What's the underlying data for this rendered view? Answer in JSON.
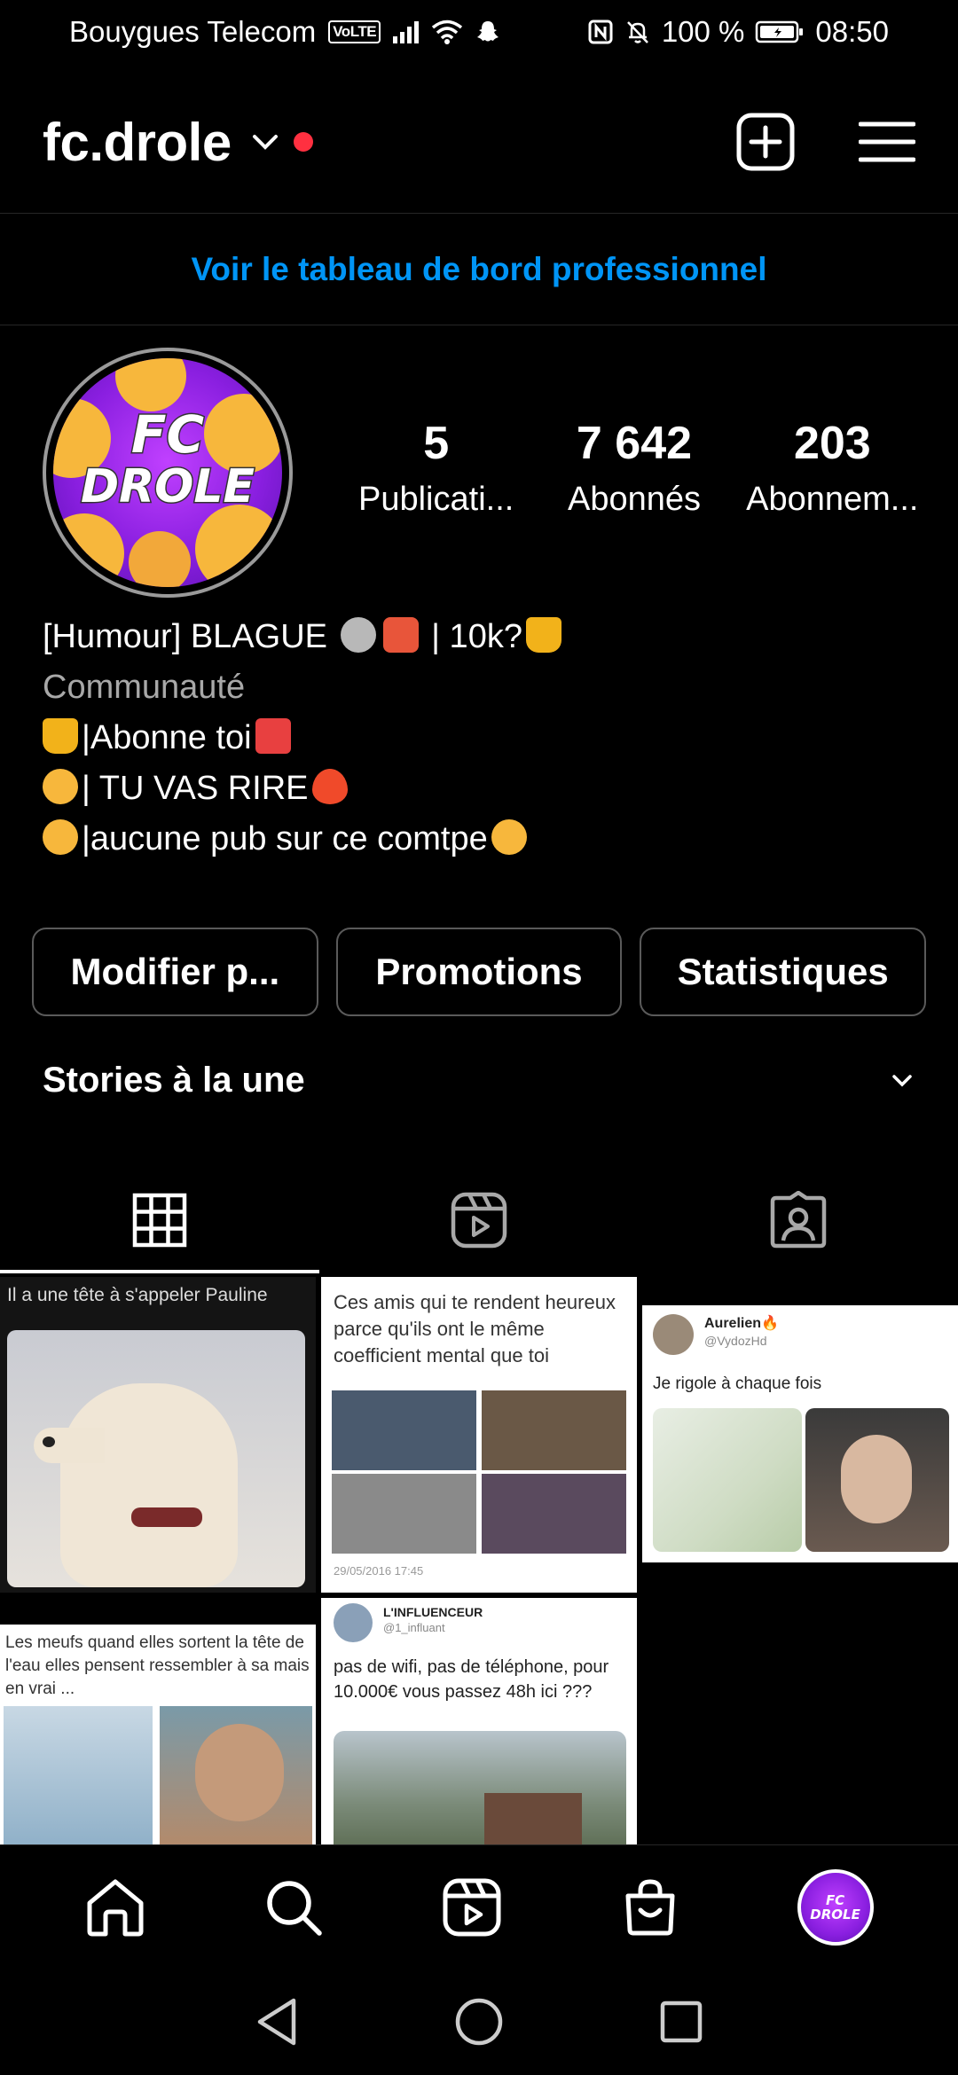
{
  "status_bar": {
    "carrier": "Bouygues Telecom",
    "volte": "VoLTE",
    "battery": "100 %",
    "time": "08:50"
  },
  "header": {
    "username": "fc.drole",
    "notification_dot_color": "#ff3040"
  },
  "dashboard_link": "Voir le tableau de bord professionnel",
  "profile": {
    "avatar_text_line1": "FC",
    "avatar_text_line2": "DROLE",
    "stats": [
      {
        "value": "5",
        "label": "Publicati..."
      },
      {
        "value": "7 642",
        "label": "Abonnés"
      },
      {
        "value": "203",
        "label": "Abonnem..."
      }
    ],
    "bio": {
      "line1": "[Humour] BLAGUE",
      "line1_tail": "| 10k?",
      "category": "Communauté",
      "line3": "|Abonne toi",
      "line4": "| TU VAS RIRE",
      "line5": "|aucune pub sur ce comtpe"
    }
  },
  "buttons": {
    "edit": "Modifier p...",
    "promotions": "Promotions",
    "insights": "Statistiques"
  },
  "highlights_title": "Stories à la une",
  "posts": [
    {
      "caption": "Il a une tête à s'appeler Pauline"
    },
    {
      "caption": "Ces amis qui te rendent heureux parce qu'ils ont le même coefficient mental que toi",
      "date": "29/05/2016 17:45"
    },
    {
      "author": "Aurelien🔥",
      "handle": "@VydozHd",
      "caption": "Je rigole à chaque fois"
    },
    {
      "caption": "Les meufs quand elles sortent la tête de l'eau elles pensent ressembler à sa mais en vrai ..."
    },
    {
      "author": "L'INFLUENCEUR",
      "handle": "@1_influant",
      "caption": "pas de wifi, pas de téléphone, pour 10.000€ vous passez 48h ici ???"
    }
  ],
  "colors": {
    "accent_blue": "#0095f6",
    "background": "#000000",
    "border": "#262626"
  }
}
